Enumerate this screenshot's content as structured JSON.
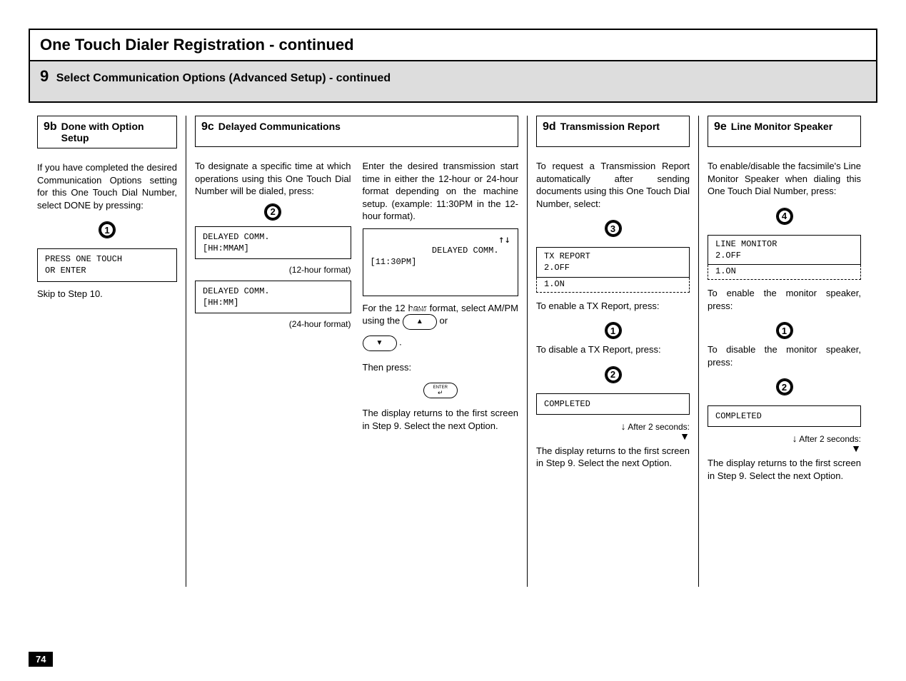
{
  "page_number": "74",
  "title": "One Touch Dialer Registration - continued",
  "step": {
    "number": "9",
    "subtitle": "Select Communication Options (Advanced Setup) - continued"
  },
  "col9b": {
    "code": "9b",
    "title": "Done with Option Setup",
    "body": "If you have completed the desired Communication Options setting for this One Touch Dial Number, select DONE by pressing:",
    "btn": "1",
    "lcd": "PRESS ONE TOUCH\nOR ENTER",
    "skip": "Skip to Step 10."
  },
  "col9c": {
    "code": "9c",
    "title": "Delayed Communications",
    "left_body": "To designate a specific time at which operations using this One Touch Dial Number will be dialed, press:",
    "left_btn": "2",
    "left_lcd1": "DELAYED COMM.\n[HH:MMAM]",
    "left_caption1": "(12-hour format)",
    "left_lcd2": "DELAYED COMM.\n[HH:MM]",
    "left_caption2": "(24-hour format)",
    "right_body1": "Enter the desired transmission start time in either the 12-hour or 24-hour format depending on the machine setup. (example: 11:30PM in the 12-hour format).",
    "right_lcd": "DELAYED COMM.\n[11:30PM]",
    "right_arrows": "↑↓",
    "right_body2_pre": "For the 12 hour format, select AM/PM using the ",
    "right_body2_mid": " or ",
    "right_body2_post": " .",
    "right_then": "Then press:",
    "right_enter": "ENTER",
    "menu_label": "MENU",
    "right_return": "The display returns to the first screen in Step 9. Select the next Option."
  },
  "col9d": {
    "code": "9d",
    "title": "Transmission Report",
    "body": "To request a Transmission Report automatically after sending documents using this One Touch Dial Number, select:",
    "btn": "3",
    "dd_line1": "TX REPORT",
    "dd_line2": "2.OFF",
    "dd_drop": "1.ON",
    "enable_text": "To enable a TX Report, press:",
    "enable_btn": "1",
    "disable_text": "To disable a TX Report, press:",
    "disable_btn": "2",
    "completed": "COMPLETED",
    "after": "After 2 seconds:",
    "return_text": "The display returns to the first screen in Step 9. Select the next Option."
  },
  "col9e": {
    "code": "9e",
    "title": "Line Monitor Speaker",
    "body": "To enable/disable the facsimile's Line Monitor Speaker when dialing this One Touch Dial Number, press:",
    "btn": "4",
    "dd_line1": "LINE MONITOR",
    "dd_line2": "2.OFF",
    "dd_drop": "1.ON",
    "enable_text": "To enable the monitor speaker, press:",
    "enable_btn": "1",
    "disable_text": "To disable the monitor speaker, press:",
    "disable_btn": "2",
    "completed": "COMPLETED",
    "after": "After 2 seconds:",
    "return_text": "The display returns to the first screen in Step 9. Select the next Option."
  }
}
